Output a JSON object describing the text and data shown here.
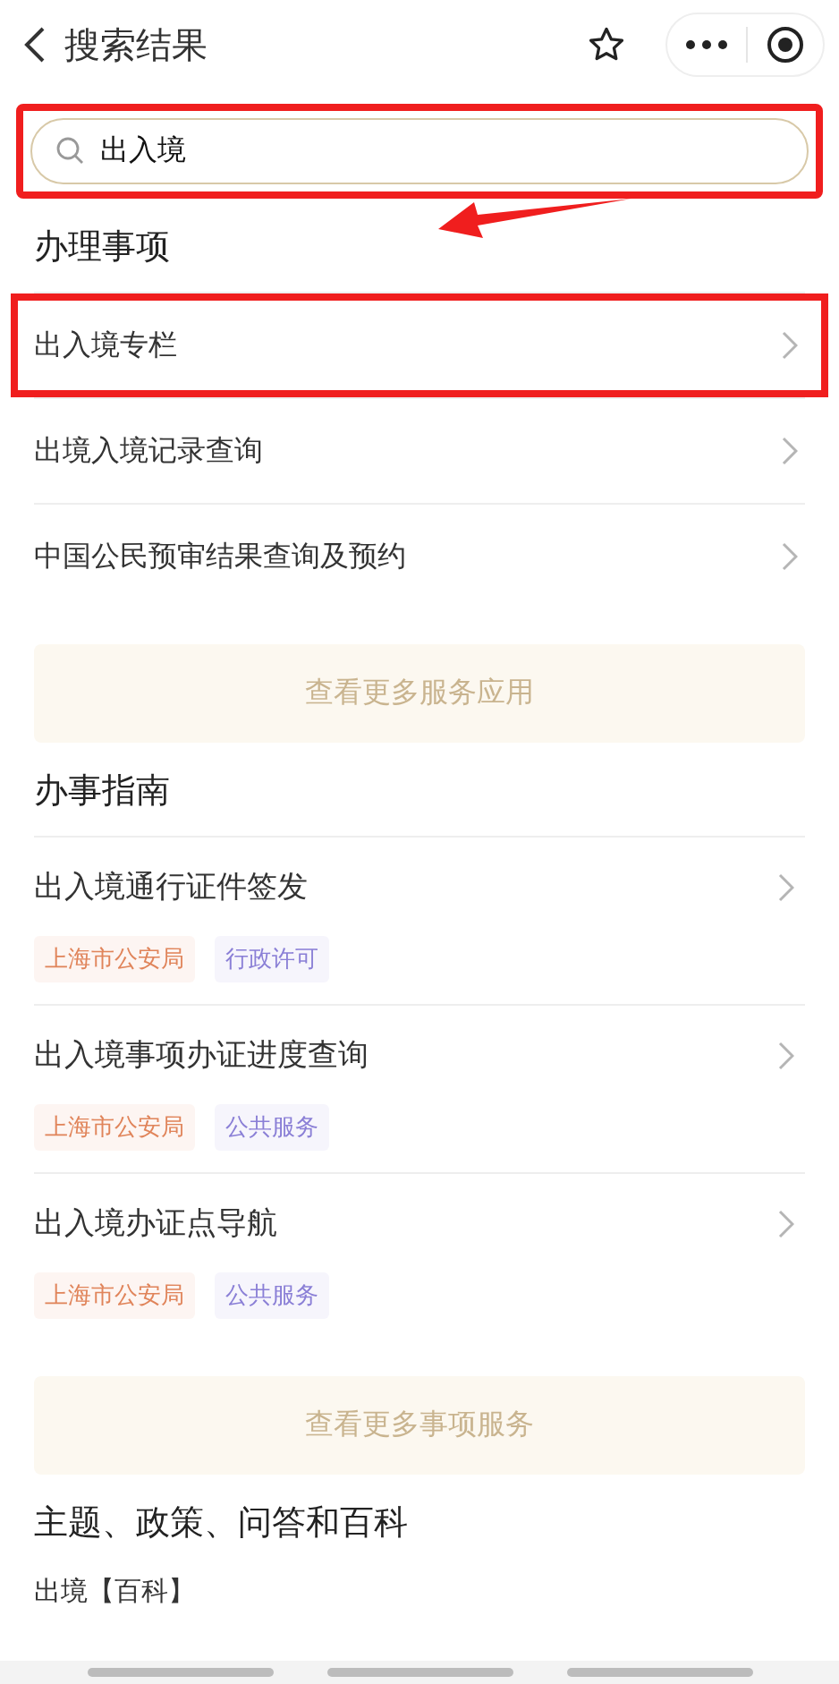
{
  "header": {
    "title": "搜索结果"
  },
  "search": {
    "value": "出入境",
    "annotated": true
  },
  "sections": [
    {
      "title": "办理事项",
      "kind": "list",
      "annotation_arrow": true,
      "items": [
        {
          "label": "出入境专栏",
          "annotated": true
        },
        {
          "label": "出境入境记录查询",
          "annotated": false
        },
        {
          "label": "中国公民预审结果查询及预约",
          "annotated": false
        }
      ],
      "more_button": "查看更多服务应用"
    },
    {
      "title": "办事指南",
      "kind": "guide",
      "annotation_arrow": false,
      "items": [
        {
          "label": "出入境通行证件签发",
          "tags": [
            {
              "text": "上海市公安局",
              "color": "#e0845a"
            },
            {
              "text": "行政许可",
              "color": "#8a7fd6"
            }
          ]
        },
        {
          "label": "出入境事项办证进度查询",
          "tags": [
            {
              "text": "上海市公安局",
              "color": "#e0845a"
            },
            {
              "text": "公共服务",
              "color": "#8a7fd6"
            }
          ]
        },
        {
          "label": "出入境办证点导航",
          "tags": [
            {
              "text": "上海市公安局",
              "color": "#e0845a"
            },
            {
              "text": "公共服务",
              "color": "#8a7fd6"
            }
          ]
        }
      ],
      "more_button": "查看更多事项服务"
    },
    {
      "title": "主题、政策、问答和百科",
      "kind": "plain",
      "annotation_arrow": false,
      "items": [
        {
          "label": "出境【百科】"
        }
      ]
    }
  ]
}
